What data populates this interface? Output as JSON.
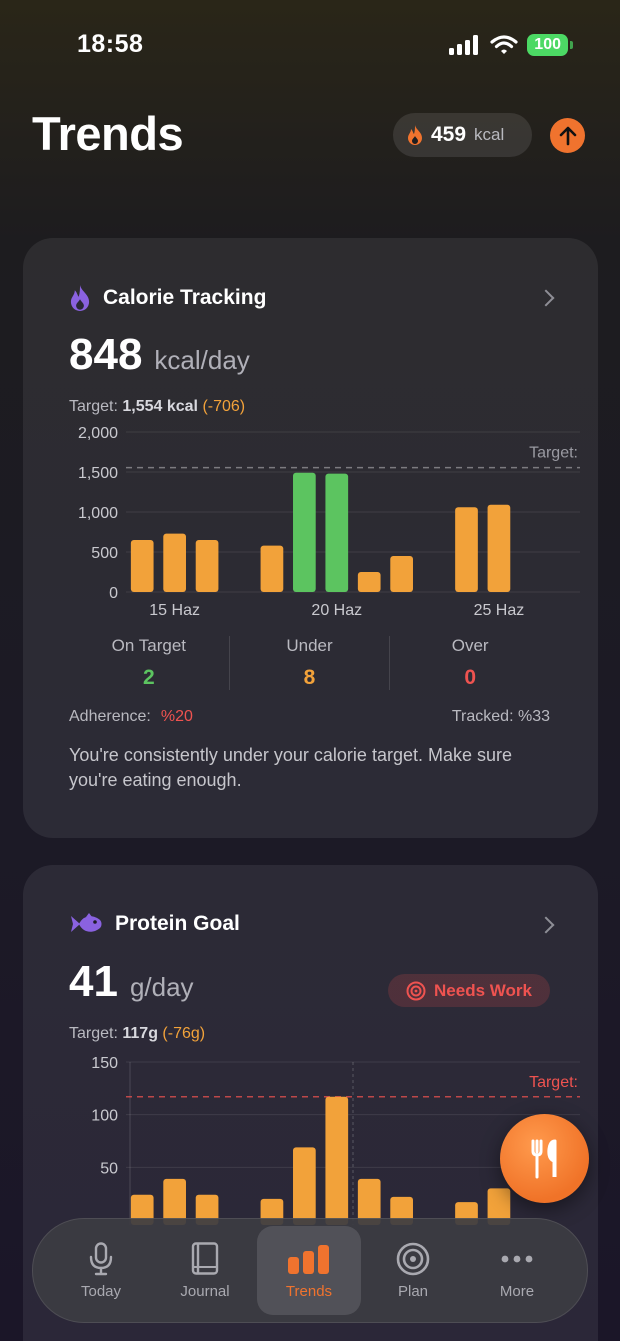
{
  "status_bar": {
    "time": "18:58",
    "battery": "100"
  },
  "header": {
    "title": "Trends",
    "kcal_value": "459",
    "kcal_unit": "kcal"
  },
  "calorie_card": {
    "title": "Calorie Tracking",
    "value": "848",
    "unit": "kcal/day",
    "target_label": "Target:",
    "target_value": "1,554 kcal",
    "target_delta": "(-706)",
    "chart_target_label": "Target:",
    "stats": [
      {
        "label": "On Target",
        "value": "2",
        "color": "#5cc460"
      },
      {
        "label": "Under",
        "value": "8",
        "color": "#f2a23a"
      },
      {
        "label": "Over",
        "value": "0",
        "color": "#ef5350"
      }
    ],
    "adherence_label": "Adherence:",
    "adherence_value": "%20",
    "tracked": "Tracked: %33",
    "note": "You're consistently under your calorie target. Make sure you're eating enough."
  },
  "protein_card": {
    "title": "Protein Goal",
    "value": "41",
    "unit": "g/day",
    "badge": "Needs Work",
    "target_label": "Target:",
    "target_value": "117g",
    "target_delta": "(-76g)",
    "chart_target_label": "Target:"
  },
  "tabs": [
    {
      "label": "Today",
      "icon": "microphone-icon"
    },
    {
      "label": "Journal",
      "icon": "book-icon"
    },
    {
      "label": "Trends",
      "icon": "bar-chart-icon",
      "active": true
    },
    {
      "label": "Plan",
      "icon": "target-icon"
    },
    {
      "label": "More",
      "icon": "more-dots-icon"
    }
  ],
  "chart_data": [
    {
      "type": "bar",
      "title": "Calorie Tracking",
      "x_tick_labels": [
        "15 Haz",
        "20 Haz",
        "25 Haz"
      ],
      "y_ticks": [
        "0",
        "500",
        "1,000",
        "1,500",
        "2,000"
      ],
      "ylim": [
        0,
        2000
      ],
      "target": 1554,
      "bars": [
        {
          "day": 14,
          "value": 650,
          "status": "under"
        },
        {
          "day": 15,
          "value": 730,
          "status": "under"
        },
        {
          "day": 16,
          "value": 650,
          "status": "under"
        },
        {
          "day": 18,
          "value": 580,
          "status": "under"
        },
        {
          "day": 19,
          "value": 1490,
          "status": "on_target"
        },
        {
          "day": 20,
          "value": 1480,
          "status": "on_target"
        },
        {
          "day": 21,
          "value": 250,
          "status": "under"
        },
        {
          "day": 22,
          "value": 450,
          "status": "under"
        },
        {
          "day": 24,
          "value": 1060,
          "status": "under"
        },
        {
          "day": 25,
          "value": 1090,
          "status": "under"
        }
      ],
      "colors": {
        "under": "#f2a23a",
        "on_target": "#5cc460"
      }
    },
    {
      "type": "bar",
      "title": "Protein Goal",
      "y_ticks": [
        "50",
        "100",
        "150"
      ],
      "ylim": [
        0,
        150
      ],
      "target": 117,
      "bars": [
        {
          "day": 14,
          "value": 24
        },
        {
          "day": 15,
          "value": 39
        },
        {
          "day": 16,
          "value": 24
        },
        {
          "day": 18,
          "value": 20
        },
        {
          "day": 19,
          "value": 69
        },
        {
          "day": 20,
          "value": 117
        },
        {
          "day": 21,
          "value": 39
        },
        {
          "day": 22,
          "value": 22
        },
        {
          "day": 24,
          "value": 17
        },
        {
          "day": 25,
          "value": 30
        }
      ],
      "colors": {
        "bar": "#f2a23a",
        "target": "#ef5350"
      }
    }
  ]
}
